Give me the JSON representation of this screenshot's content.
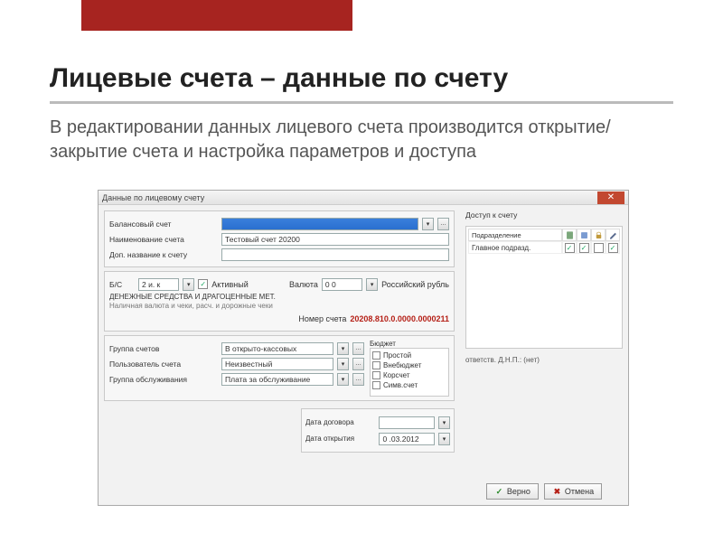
{
  "slide": {
    "title": "Лицевые счета – данные по счету",
    "subtitle": "В редактировании данных лицевого счета производится открытие/закрытие счета и настройка параметров и доступа"
  },
  "window": {
    "title": "Данные по лицевому счету",
    "labels": {
      "bal_acct": "Балансовый счет",
      "acct_name": "Наименование счета",
      "client_doc": "Доп. название к счету",
      "bs": "Б/С",
      "active": "Активный",
      "currency": "Валюта",
      "account_section_title": "ДЕНЕЖНЫЕ СРЕДСТВА И ДРАГОЦЕННЫЕ МЕТ.",
      "account_section_sub": "Наличная валюта и чеки, расч. и дорожные чеки",
      "account_num_lbl": "Номер счета",
      "group_acct": "Группа счетов",
      "user": "Пользователь счета",
      "group_service": "Группа обслуживания",
      "budget": "Бюджет",
      "date_contract": "Дата договора",
      "date_open": "Дата открытия",
      "access_title": "Доступ к счету",
      "col_dept": "Подразделение",
      "sig_lbl": "ответств. Д.Н.П.:"
    },
    "values": {
      "bal_acct": "",
      "acct_name": "Тестовый счет 20200",
      "client_doc": "",
      "bs": "2 и. к",
      "active_checked": true,
      "currency_code": "0 0",
      "currency_name": "Российский рубль",
      "account_number": "20208.810.0.0000.0000211",
      "group_acct": "В открыто-кассовых",
      "user": "Неизвестный",
      "group_service": "Плата за обслуживание",
      "budget_items": [
        {
          "label": "Простой",
          "checked": false
        },
        {
          "label": "Внебюджет",
          "checked": false
        },
        {
          "label": "Корсчет",
          "checked": false
        },
        {
          "label": "Симв.счет",
          "checked": false
        }
      ],
      "access_rows": [
        {
          "name": "Главное подразд.",
          "c1": true,
          "c2": true,
          "c3": false,
          "c4": true
        }
      ],
      "sig_value": "(нет)",
      "date_contract": "",
      "date_open": "0 .03.2012"
    },
    "buttons": {
      "ok": "Верно",
      "cancel": "Отмена"
    }
  }
}
